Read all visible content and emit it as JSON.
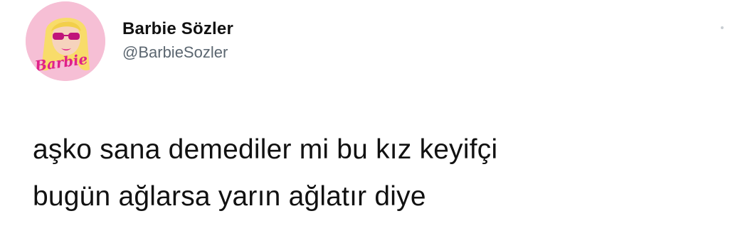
{
  "tweet": {
    "display_name": "Barbie Sözler",
    "handle": "@BarbieSozler",
    "avatar_logo_text": "Barbie",
    "text": "aşko sana demediler mi bu kız keyifçi\nbugün ağlarsa yarın ağlatır diye",
    "more_icon": "more-options-icon"
  },
  "colors": {
    "avatar_bg": "#f4b6cf",
    "logo_pink": "#e0218a",
    "text": "#111111",
    "handle": "#5b6670"
  }
}
